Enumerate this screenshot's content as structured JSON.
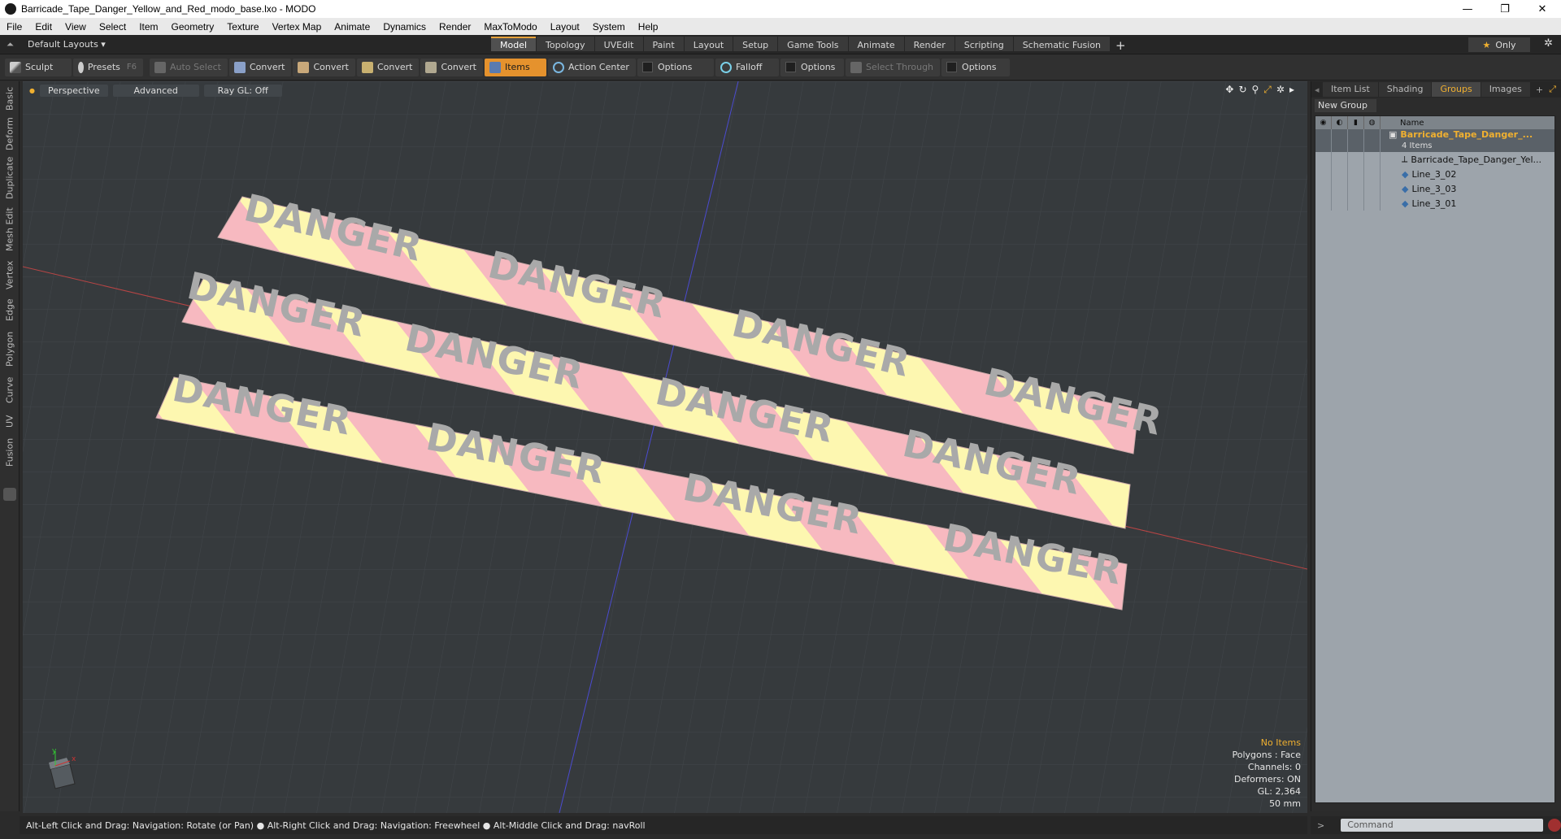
{
  "window": {
    "title": "Barricade_Tape_Danger_Yellow_and_Red_modo_base.lxo - MODO",
    "minimize": "—",
    "maximize": "❐",
    "close": "✕"
  },
  "menu": [
    "File",
    "Edit",
    "View",
    "Select",
    "Item",
    "Geometry",
    "Texture",
    "Vertex Map",
    "Animate",
    "Dynamics",
    "Render",
    "MaxToModo",
    "Layout",
    "System",
    "Help"
  ],
  "layoutbar": {
    "layouts_label": "Default Layouts ▾",
    "tabs": [
      "Model",
      "Topology",
      "UVEdit",
      "Paint",
      "Layout",
      "Setup",
      "Game Tools",
      "Animate",
      "Render",
      "Scripting",
      "Schematic Fusion"
    ],
    "active_tab": "Model",
    "plus": "+",
    "only_label": "Only",
    "star": "★",
    "gear": "✲"
  },
  "toolbar": {
    "sculpt": "Sculpt",
    "presets": "Presets",
    "presets_key": "F6",
    "auto_select": "Auto Select",
    "convert1": "Convert",
    "convert2": "Convert",
    "convert3": "Convert",
    "convert4": "Convert",
    "items": "Items",
    "action_center": "Action Center",
    "options1": "Options",
    "falloff": "Falloff",
    "options2": "Options",
    "select_through": "Select Through",
    "options3": "Options"
  },
  "left_tabs": [
    "Basic",
    "Deform",
    "Duplicate",
    "Mesh Edit",
    "Vertex",
    "Edge",
    "Polygon",
    "Curve",
    "UV",
    "Fusion"
  ],
  "viewport": {
    "perspective": "Perspective",
    "advanced": "Advanced",
    "raygl": "Ray GL: Off",
    "tape_word": "DANGER",
    "axis_y": "y",
    "axis_x": "x",
    "stats": {
      "no_items": "No Items",
      "polygons": "Polygons : Face",
      "channels": "Channels: 0",
      "deformers": "Deformers: ON",
      "gl": "GL: 2,364",
      "scale": "50 mm"
    }
  },
  "status_text": "Alt-Left Click and Drag: Navigation: Rotate (or Pan) ● Alt-Right Click and Drag: Navigation: Freewheel ● Alt-Middle Click and Drag: navRoll",
  "right_panel": {
    "tabs": [
      "Item List",
      "Shading",
      "Groups",
      "Images"
    ],
    "active_tab": "Groups",
    "plus": "+",
    "new_group": "New Group",
    "name_header": "Name",
    "group_name": "Barricade_Tape_Danger_...",
    "group_count": "4 Items",
    "items": [
      "Barricade_Tape_Danger_Yel...",
      "Line_3_02",
      "Line_3_03",
      "Line_3_01"
    ]
  },
  "command_placeholder": "Command",
  "colors": {
    "accent": "#e5922d",
    "tape_yellow": "#fdf7b0",
    "tape_pink": "#f7b9c0",
    "text_on_tape": "#a9a9a9"
  }
}
